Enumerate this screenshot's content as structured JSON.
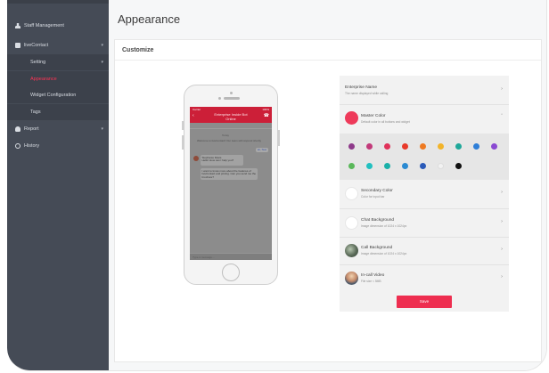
{
  "sidebar": {
    "items": [
      {
        "label": "Staff Management",
        "icon": "user-icon"
      },
      {
        "label": "liveContact",
        "icon": "chat-icon"
      },
      {
        "label": "Setting"
      },
      {
        "label": "Appearance"
      },
      {
        "label": "Widget Configuration"
      },
      {
        "label": "Tags"
      },
      {
        "label": "Report",
        "icon": "report-icon"
      },
      {
        "label": "History",
        "icon": "clock-icon"
      }
    ],
    "active_color": "#ff3355"
  },
  "page": {
    "title": "Appearance"
  },
  "card": {
    "title": "Customize"
  },
  "phone": {
    "status_left": "Carrier",
    "status_right": "100%",
    "header_line1": "Enterprise Inside Bot",
    "header_line2": "Online",
    "time_label": "Today",
    "system_msg": "Welcome to liveContact! Our team will respond shortly",
    "user_msg": "Hi, Test",
    "agent_name": "Stephanie Davis",
    "agent_text": "Hello! How can I help you?",
    "reply_text": "I want to know more about the features of liveContact and pricing. Can you send me the brochure?",
    "input_placeholder": "Type a message..."
  },
  "settings": {
    "enterprise": {
      "name": "Enterprise Name",
      "desc": "The name displayed while calling"
    },
    "master": {
      "name": "Master Color",
      "desc": "Default color in all buttons and widget"
    },
    "swatch_rows": [
      [
        "#8e3a8a",
        "#c23a7a",
        "#e0325a",
        "#e83a2a",
        "#ee7a22",
        "#f2b42a",
        "#1fa89a",
        "#2f7fd8",
        "#8a4ad2"
      ],
      [
        "#5ab85a",
        "#22c0c0",
        "#1ab0a8",
        "#2a8ad2",
        "#2a5ab8",
        "#f2f2f2",
        "#111111"
      ]
    ],
    "rows": [
      {
        "name": "Secondary Color",
        "desc": "Color for input bar"
      },
      {
        "name": "Chat Background",
        "desc": "Image dimension of 1024 x 1024px"
      },
      {
        "name": "Call Background",
        "desc": "Image dimension of 1024 x 1024px"
      },
      {
        "name": "In-call Video",
        "desc": "File size < 5MB"
      }
    ],
    "save_label": "Save"
  },
  "colors": {
    "brand_red": "#ee2e50",
    "sidebar": "#454b56"
  }
}
